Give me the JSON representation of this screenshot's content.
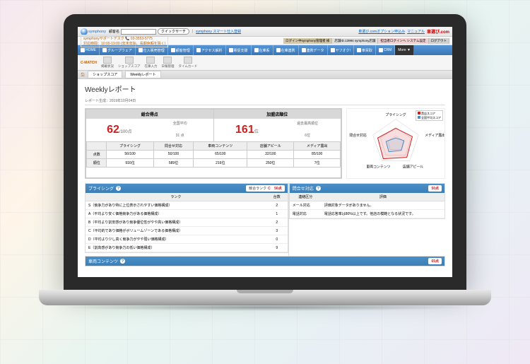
{
  "brand": "symphony",
  "search": {
    "label": "顧客名",
    "quick": "クイックサーチ",
    "sep": "｜",
    "link": "symphony スマート仕入登録"
  },
  "topright": {
    "opt": "車選び.comオプション申込み",
    "manual": "マニュアル",
    "brand": "車選び.com"
  },
  "support": {
    "name": "symphonyサポートデスク",
    "tel": "📞 03-3553-5775",
    "hours": "対応時間：10:00-19:00 (年末年始、長期休暇を除く)"
  },
  "user": {
    "login": "ログイン中symphony管理者 様",
    "shop": "店舗ID.13984 symphony店舗",
    "admin": "担当者ログインへ システム設定",
    "logout": "ログアウト"
  },
  "nav": [
    "HOME",
    "グループウェア",
    "仕入販売管理",
    "顧客管理",
    "アクセス解析",
    "販促支援",
    "在庫系",
    "在庫連携",
    "連携データ",
    "ヤフオク!",
    "車買取",
    "CRM",
    "More ▼"
  ],
  "tools": {
    "cmatch": "C-MATCH",
    "t1": "掲載状況",
    "t2": "ショップスコア",
    "t3": "在庫入力",
    "t4": "日報管理",
    "t5": "タイムカード"
  },
  "breadcrumb": [
    "ショップスコア",
    "Weeklyレポート"
  ],
  "title": "Weeklyレポート",
  "gen": "レポート生成：2019年10月04日",
  "scores": {
    "h1": "総合得点",
    "h2": "加盟店順位",
    "val": "62",
    "unit": "/100点",
    "avg_l": "全国平均",
    "avg_v": "31 点",
    "rank": "161",
    "rank_u": "位",
    "best_l": "過去最高順位",
    "best_v": "6位",
    "cols": [
      "プライシング",
      "問合せ対応",
      "車両コンテンツ",
      "店舗アピール",
      "メディア露出"
    ],
    "r1": "点数",
    "r1v": [
      "56/100",
      "50/100",
      "65/100",
      "32/100",
      "85/100"
    ],
    "r2": "順位",
    "r2v": [
      "916位",
      "589位",
      "216位",
      "250位",
      "7位"
    ]
  },
  "radar": {
    "axes": [
      "プライシング",
      "メディア露出",
      "店舗アピール",
      "車両コンテンツ",
      "問合せ対応"
    ],
    "leg1": "貴店スコア",
    "leg2": "全国平均スコア"
  },
  "pricing": {
    "title": "プライシング",
    "rank_l": "競合ランク",
    "rank_g": "C",
    "pts": "56点",
    "h1": "ランク",
    "h2": "台数",
    "rows": [
      [
        "S（競争力があり特に上位表示されやすい価格構成）",
        "2"
      ],
      [
        "A（平均より安く価格競争力がある価格構成）",
        "1"
      ],
      [
        "B（平均より割安感があり競争優位性がやや高い価格構成）",
        "2"
      ],
      [
        "C（平均的であり価格がボリュームゾーンである価格構成）",
        "3"
      ],
      [
        "D（平均より少し高く競争力がやや弱い価格構成）",
        "0"
      ],
      [
        "E（割高感があり競争力の低い価格構成）",
        "9"
      ]
    ]
  },
  "inquiry": {
    "title": "問合せ対応",
    "pts": "50点",
    "h1": "連絡区分",
    "h2": "評価",
    "rows": [
      [
        "メール対応",
        "評価対象データがありません。"
      ],
      [
        "電話対応",
        "電話応答率は80%以上です。他店の模範となる状況です。"
      ]
    ]
  },
  "vcontent": {
    "title": "車両コンテンツ",
    "pts": "65点"
  }
}
